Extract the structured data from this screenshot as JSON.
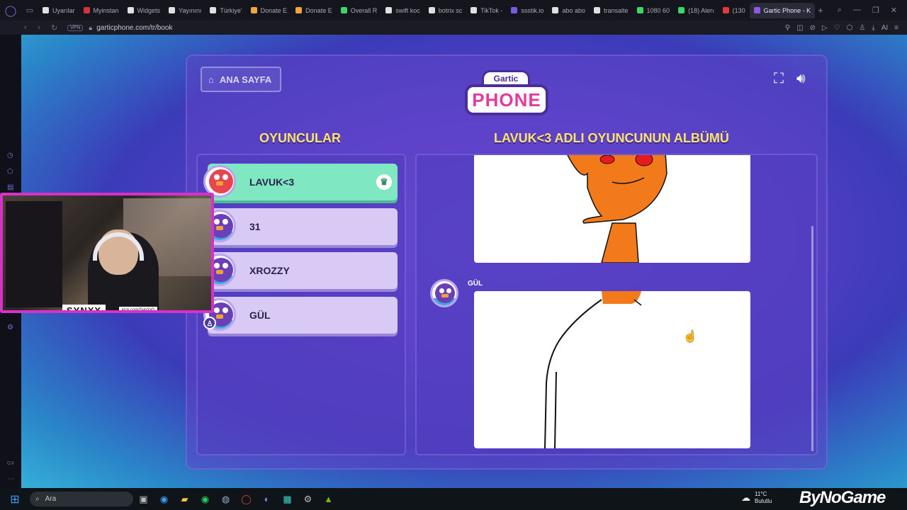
{
  "browser": {
    "tabs": [
      {
        "label": "Uyarılar",
        "color": "#e0e0e0"
      },
      {
        "label": "Myinstan",
        "color": "#d6333a"
      },
      {
        "label": "Widgets",
        "color": "#e0e0e0"
      },
      {
        "label": "Yayınını",
        "color": "#e0e0e0"
      },
      {
        "label": "Türkiye'",
        "color": "#e0e0e0"
      },
      {
        "label": "Donate E",
        "color": "#f2a63a"
      },
      {
        "label": "Donate E",
        "color": "#f2a63a"
      },
      {
        "label": "Overall R",
        "color": "#3ad66a"
      },
      {
        "label": "swift koc",
        "color": "#e0e0e0"
      },
      {
        "label": "botrix sc",
        "color": "#e0e0e0"
      },
      {
        "label": "TikTok -",
        "color": "#e0e0e0"
      },
      {
        "label": "ssstik.io",
        "color": "#7a5ae0"
      },
      {
        "label": "abo abo",
        "color": "#e0e0e0"
      },
      {
        "label": "transalte",
        "color": "#e0e0e0"
      },
      {
        "label": "1080 60",
        "color": "#3ad66a"
      },
      {
        "label": "(18) Alerı",
        "color": "#3ad66a"
      },
      {
        "label": "(130",
        "color": "#e03a3a"
      },
      {
        "label": "Gartic Phone - K",
        "color": "#8a5ae0"
      }
    ],
    "vpn_label": "VPN",
    "url": "garticphone.com/tr/book",
    "ai_label": "AI"
  },
  "game": {
    "home_button_label": "ANA SAYFA",
    "logo_top": "Gartic",
    "logo_main": "PHONE",
    "players_title": "OYUNCULAR",
    "album_title": "LAVUK<3 ADLI OYUNCUNUN ALBÜMÜ",
    "players": [
      {
        "name": "LAVUK<3"
      },
      {
        "name": "31"
      },
      {
        "name": "XROZZY"
      },
      {
        "name": "GÜL"
      }
    ],
    "album_author": "GÜL"
  },
  "webcam": {
    "name": "SYNXX",
    "link": "kick.com/SynXx0"
  },
  "taskbar": {
    "search_label": "Ara",
    "temperature": "11°C",
    "weather_desc": "Bulutlu",
    "watermark": "ByNoGame"
  },
  "colors": {
    "accent_yellow": "#ffe36a",
    "host_green": "#7fe8c2",
    "player_lavender": "#d9c9f5",
    "webcam_border": "#d632c8"
  }
}
